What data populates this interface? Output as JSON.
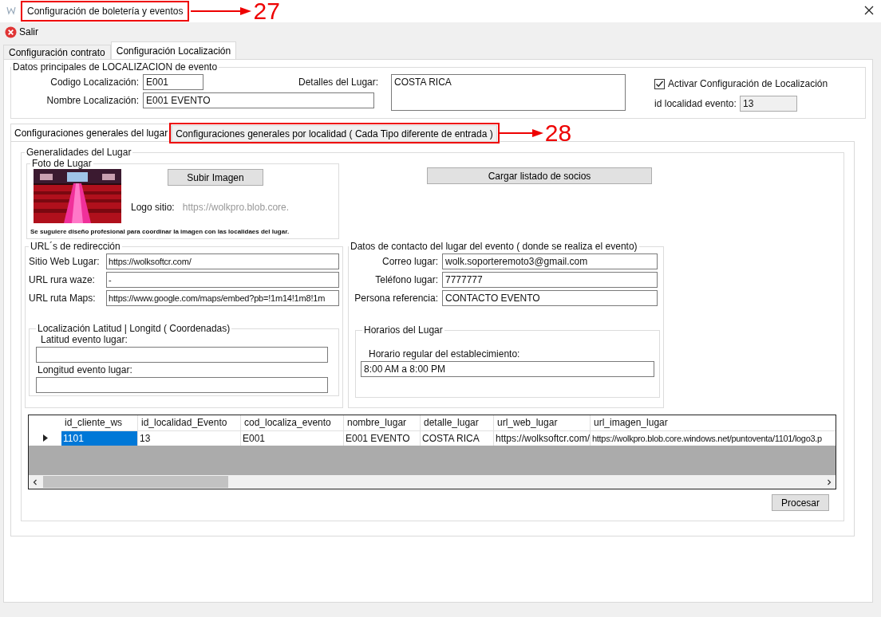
{
  "window": {
    "title": "Configuración de boletería y eventos",
    "callout": "27"
  },
  "toolbar": {
    "exit_label": "Salir"
  },
  "tabs": [
    {
      "label": "Configuración contrato",
      "selected": false
    },
    {
      "label": "Configuración Localización",
      "selected": true
    }
  ],
  "main_group": {
    "title": "Datos principales de LOCALIZACION de evento",
    "codigo_label": "Codigo Localización:",
    "codigo": "E001",
    "nombre_label": "Nombre Localización:",
    "nombre": "E001 EVENTO",
    "detalles_label": "Detalles del Lugar:",
    "detalles": "COSTA RICA",
    "activar_label": "Activar Configuración de Localización",
    "activar_checked": true,
    "id_label": "id localidad evento:",
    "id_value": "13"
  },
  "inner_tabs": [
    {
      "label": "Configuraciones generales del lugar",
      "selected": true
    },
    {
      "label": "Configuraciones generales por localidad ( Cada Tipo diferente de entrada )",
      "selected": false,
      "callout": "28"
    }
  ],
  "generalidades": {
    "title": "Generalidades del Lugar",
    "foto": {
      "title": "Foto de Lugar",
      "upload_button": "Subir Imagen",
      "logo_label": "Logo sitio:",
      "logo_url": "https://wolkpro.blob.core.",
      "note": "Se suguiere diseño profesional para coordinar la imagen con las localidaes del lugar."
    },
    "load_button": "Cargar listado de socios",
    "urls": {
      "title": "URL´s de redirección",
      "fields": [
        {
          "label": "Sitio Web Lugar:",
          "value": "https://wolksoftcr.com/"
        },
        {
          "label": "URL rura waze:",
          "value": "-"
        },
        {
          "label": "URL ruta Maps:",
          "value": "https://www.google.com/maps/embed?pb=!1m14!1m8!1m"
        }
      ],
      "coords": {
        "title": "Localización Latitud | Longitd ( Coordenadas)",
        "fields": [
          {
            "label": "Latitud evento lugar:"
          },
          {
            "label": "Longitud evento lugar:"
          }
        ]
      }
    },
    "contact": {
      "title": "Datos de contacto del lugar del evento ( donde se realiza el evento)",
      "fields": [
        {
          "label": "Correo lugar:",
          "value": "wolk.soporteremoto3@gmail.com"
        },
        {
          "label": "Teléfono lugar:",
          "value": "7777777"
        },
        {
          "label": "Persona referencia:",
          "value": "CONTACTO EVENTO"
        }
      ],
      "schedule": {
        "title": "Horarios del Lugar",
        "label": "Horario regular del establecimiento:",
        "value": "8:00 AM a 8:00 PM"
      }
    }
  },
  "table": {
    "columns": [
      "id_cliente_ws",
      "id_localidad_Evento",
      "cod_localiza_evento",
      "nombre_lugar",
      "detalle_lugar",
      "url_web_lugar",
      "url_imagen_lugar"
    ],
    "rows": [
      {
        "current": true,
        "cells": [
          {
            "text": "1101",
            "selected": true
          },
          {
            "text": "13",
            "selected": false
          },
          {
            "text": "E001",
            "selected": false
          },
          {
            "text": "E001 EVENTO",
            "selected": false
          },
          {
            "text": "COSTA RICA",
            "selected": false
          },
          {
            "text": "https://wolksoftcr.com/",
            "selected": false
          },
          {
            "text": "https://wolkpro.blob.core.windows.net/puntoventa/1101/logo3.p",
            "selected": false
          }
        ]
      }
    ]
  },
  "process_button": "Procesar"
}
